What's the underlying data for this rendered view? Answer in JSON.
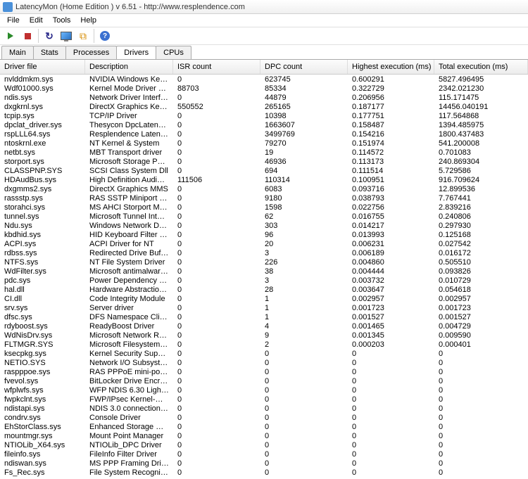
{
  "window": {
    "title": "LatencyMon  (Home Edition )   v 6.51 - http://www.resplendence.com"
  },
  "menu": {
    "items": [
      "File",
      "Edit",
      "Tools",
      "Help"
    ]
  },
  "tabs": {
    "items": [
      "Main",
      "Stats",
      "Processes",
      "Drivers",
      "CPUs"
    ],
    "active": 3
  },
  "grid": {
    "columns": [
      "Driver file",
      "Description",
      "ISR count",
      "DPC count",
      "Highest execution (ms)",
      "Total execution (ms)"
    ],
    "rows": [
      {
        "file": "nvlddmkm.sys",
        "desc": "NVIDIA Windows Kernel Mod...",
        "isr": "0",
        "dpc": "623745",
        "hi": "0.600291",
        "tot": "5827.496495"
      },
      {
        "file": "Wdf01000.sys",
        "desc": "Kernel Mode Driver Framew...",
        "isr": "88703",
        "dpc": "85334",
        "hi": "0.322729",
        "tot": "2342.021230"
      },
      {
        "file": "ndis.sys",
        "desc": "Network Driver Interface Sp...",
        "isr": "0",
        "dpc": "44879",
        "hi": "0.206956",
        "tot": "115.171475"
      },
      {
        "file": "dxgkrnl.sys",
        "desc": "DirectX Graphics Kernel",
        "isr": "550552",
        "dpc": "265165",
        "hi": "0.187177",
        "tot": "14456.040191"
      },
      {
        "file": "tcpip.sys",
        "desc": "TCP/IP Driver",
        "isr": "0",
        "dpc": "10398",
        "hi": "0.177751",
        "tot": "117.564868"
      },
      {
        "file": "dpclat_driver.sys",
        "desc": "Thesycon DpcLatency Driver",
        "isr": "0",
        "dpc": "1663607",
        "hi": "0.158487",
        "tot": "1394.485975"
      },
      {
        "file": "rspLLL64.sys",
        "desc": "Resplendence Latency Monit...",
        "isr": "0",
        "dpc": "3499769",
        "hi": "0.154216",
        "tot": "1800.437483"
      },
      {
        "file": "ntoskrnl.exe",
        "desc": "NT Kernel & System",
        "isr": "0",
        "dpc": "79270",
        "hi": "0.151974",
        "tot": "541.200008"
      },
      {
        "file": "netbt.sys",
        "desc": "MBT Transport driver",
        "isr": "0",
        "dpc": "19",
        "hi": "0.114572",
        "tot": "0.701083"
      },
      {
        "file": "storport.sys",
        "desc": "Microsoft Storage Port Driver",
        "isr": "0",
        "dpc": "46936",
        "hi": "0.113173",
        "tot": "240.869304"
      },
      {
        "file": "CLASSPNP.SYS",
        "desc": "SCSI Class System Dll",
        "isr": "0",
        "dpc": "694",
        "hi": "0.111514",
        "tot": "5.729586"
      },
      {
        "file": "HDAudBus.sys",
        "desc": "High Definition Audio Bus Dri...",
        "isr": "111506",
        "dpc": "110314",
        "hi": "0.100951",
        "tot": "916.709624"
      },
      {
        "file": "dxgmms2.sys",
        "desc": "DirectX Graphics MMS",
        "isr": "0",
        "dpc": "6083",
        "hi": "0.093716",
        "tot": "12.899536"
      },
      {
        "file": "rassstp.sys",
        "desc": "RAS SSTP Miniport Call Mana...",
        "isr": "0",
        "dpc": "9180",
        "hi": "0.038793",
        "tot": "7.767441"
      },
      {
        "file": "storahci.sys",
        "desc": "MS AHCI Storport Miniport D...",
        "isr": "0",
        "dpc": "1598",
        "hi": "0.022756",
        "tot": "2.839216"
      },
      {
        "file": "tunnel.sys",
        "desc": "Microsoft Tunnel Interface D...",
        "isr": "0",
        "dpc": "62",
        "hi": "0.016755",
        "tot": "0.240806"
      },
      {
        "file": "Ndu.sys",
        "desc": "Windows Network Data Usa...",
        "isr": "0",
        "dpc": "303",
        "hi": "0.014217",
        "tot": "0.297930"
      },
      {
        "file": "kbdhid.sys",
        "desc": "HID Keyboard Filter Driver",
        "isr": "0",
        "dpc": "96",
        "hi": "0.013993",
        "tot": "0.125168"
      },
      {
        "file": "ACPI.sys",
        "desc": "ACPI Driver for NT",
        "isr": "0",
        "dpc": "20",
        "hi": "0.006231",
        "tot": "0.027542"
      },
      {
        "file": "rdbss.sys",
        "desc": "Redirected Drive Buffering S...",
        "isr": "0",
        "dpc": "3",
        "hi": "0.006189",
        "tot": "0.016172"
      },
      {
        "file": "NTFS.sys",
        "desc": "NT File System Driver",
        "isr": "0",
        "dpc": "226",
        "hi": "0.004860",
        "tot": "0.505510"
      },
      {
        "file": "WdFilter.sys",
        "desc": "Microsoft antimalware file sys...",
        "isr": "0",
        "dpc": "38",
        "hi": "0.004444",
        "tot": "0.093826"
      },
      {
        "file": "pdc.sys",
        "desc": "Power Dependency Coordin...",
        "isr": "0",
        "dpc": "3",
        "hi": "0.003732",
        "tot": "0.010729"
      },
      {
        "file": "hal.dll",
        "desc": "Hardware Abstraction Layer ...",
        "isr": "0",
        "dpc": "28",
        "hi": "0.003647",
        "tot": "0.054618"
      },
      {
        "file": "CI.dll",
        "desc": "Code Integrity Module",
        "isr": "0",
        "dpc": "1",
        "hi": "0.002957",
        "tot": "0.002957"
      },
      {
        "file": "srv.sys",
        "desc": "Server driver",
        "isr": "0",
        "dpc": "1",
        "hi": "0.001723",
        "tot": "0.001723"
      },
      {
        "file": "dfsc.sys",
        "desc": "DFS Namespace Client Driver",
        "isr": "0",
        "dpc": "1",
        "hi": "0.001527",
        "tot": "0.001527"
      },
      {
        "file": "rdyboost.sys",
        "desc": "ReadyBoost Driver",
        "isr": "0",
        "dpc": "4",
        "hi": "0.001465",
        "tot": "0.004729"
      },
      {
        "file": "WdNisDrv.sys",
        "desc": "Microsoft Network Realtime I...",
        "isr": "0",
        "dpc": "9",
        "hi": "0.001345",
        "tot": "0.009590"
      },
      {
        "file": "FLTMGR.SYS",
        "desc": "Microsoft Filesystem Filter Ma...",
        "isr": "0",
        "dpc": "2",
        "hi": "0.000203",
        "tot": "0.000401"
      },
      {
        "file": "ksecpkg.sys",
        "desc": "Kernel Security Support Pro...",
        "isr": "0",
        "dpc": "0",
        "hi": "0",
        "tot": "0"
      },
      {
        "file": "NETIO.SYS",
        "desc": "Network I/O Subsystem",
        "isr": "0",
        "dpc": "0",
        "hi": "0",
        "tot": "0"
      },
      {
        "file": "raspppoe.sys",
        "desc": "RAS PPPoE mini-port/call-m...",
        "isr": "0",
        "dpc": "0",
        "hi": "0",
        "tot": "0"
      },
      {
        "file": "fvevol.sys",
        "desc": "BitLocker Drive Encryption ...",
        "isr": "0",
        "dpc": "0",
        "hi": "0",
        "tot": "0"
      },
      {
        "file": "wfplwfs.sys",
        "desc": "WFP NDIS 6.30 Lightweight ...",
        "isr": "0",
        "dpc": "0",
        "hi": "0",
        "tot": "0"
      },
      {
        "file": "fwpkclnt.sys",
        "desc": "FWP/IPsec Kernel-Mode API",
        "isr": "0",
        "dpc": "0",
        "hi": "0",
        "tot": "0"
      },
      {
        "file": "ndistapi.sys",
        "desc": "NDIS 3.0 connection wrapp...",
        "isr": "0",
        "dpc": "0",
        "hi": "0",
        "tot": "0"
      },
      {
        "file": "condrv.sys",
        "desc": "Console Driver",
        "isr": "0",
        "dpc": "0",
        "hi": "0",
        "tot": "0"
      },
      {
        "file": "EhStorClass.sys",
        "desc": "Enhanced Storage Class driv...",
        "isr": "0",
        "dpc": "0",
        "hi": "0",
        "tot": "0"
      },
      {
        "file": "mountmgr.sys",
        "desc": "Mount Point Manager",
        "isr": "0",
        "dpc": "0",
        "hi": "0",
        "tot": "0"
      },
      {
        "file": "NTIOLib_X64.sys",
        "desc": "NTIOLib_DPC Driver",
        "isr": "0",
        "dpc": "0",
        "hi": "0",
        "tot": "0"
      },
      {
        "file": "fileinfo.sys",
        "desc": "FileInfo Filter Driver",
        "isr": "0",
        "dpc": "0",
        "hi": "0",
        "tot": "0"
      },
      {
        "file": "ndiswan.sys",
        "desc": "MS PPP Framing Driver (Str...",
        "isr": "0",
        "dpc": "0",
        "hi": "0",
        "tot": "0"
      },
      {
        "file": "Fs_Rec.sys",
        "desc": "File System Recognizer Driver",
        "isr": "0",
        "dpc": "0",
        "hi": "0",
        "tot": "0"
      }
    ]
  }
}
